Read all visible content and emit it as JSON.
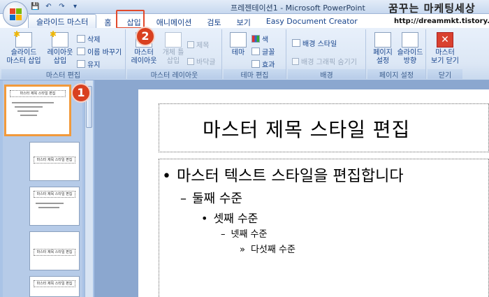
{
  "window": {
    "title": "프레젠테이션1 - Microsoft PowerPoint",
    "watermark": "꿈꾸는 마케팅세상",
    "watermark_url": "http://dreammkt.tistory.com"
  },
  "quick_access": {
    "save": "💾",
    "undo": "↶",
    "redo": "↷",
    "customize": "▾"
  },
  "tabs": [
    {
      "label": "슬라이드 마스터",
      "active": true
    },
    {
      "label": "홈"
    },
    {
      "label": "삽입"
    },
    {
      "label": "애니메이션"
    },
    {
      "label": "검토"
    },
    {
      "label": "보기"
    },
    {
      "label": "Easy Document Creator"
    }
  ],
  "ribbon": {
    "master_edit": {
      "label": "마스터 편집",
      "insert_master": "슬라이드\n마스터 삽입",
      "insert_layout": "레이아웃\n삽입",
      "delete": "삭제",
      "rename": "이름 바꾸기",
      "preserve": "유지"
    },
    "master_layout": {
      "label": "마스터 레이아웃",
      "master_layout_btn": "마스터\n레이아웃",
      "insert_placeholder": "개체 틀\n삽입",
      "title_chk": "제목",
      "footer_chk": "바닥글"
    },
    "theme_edit": {
      "label": "테마 편집",
      "themes": "테마",
      "colors": "색",
      "fonts": "글꼴",
      "effects": "효과"
    },
    "background": {
      "label": "배경",
      "bg_styles": "배경 스타일",
      "hide_bg": "배경 그래픽 숨기기"
    },
    "page_setup": {
      "label": "페이지 설정",
      "page_setup_btn": "페이지\n설정",
      "orientation": "슬라이드\n방향"
    },
    "close": {
      "label": "닫기",
      "close_master": "마스터\n보기 닫기"
    }
  },
  "thumbnails": {
    "first_number": "1",
    "first_title": "마스터 제목 스타일 편집"
  },
  "slide": {
    "title": "마스터 제목 스타일 편집",
    "levels": [
      {
        "bullet": "•",
        "text": "마스터 텍스트 스타일을 편집합니다"
      },
      {
        "bullet": "–",
        "text": "둘째 수준"
      },
      {
        "bullet": "•",
        "text": "셋째 수준"
      },
      {
        "bullet": "–",
        "text": "넷째 수준"
      },
      {
        "bullet": "»",
        "text": "다섯째 수준"
      }
    ]
  },
  "callouts": {
    "one": "1",
    "two": "2"
  },
  "colors": {
    "accent": "#d9401f",
    "selection": "#f29a3b",
    "ribbon_text": "#15428b"
  }
}
